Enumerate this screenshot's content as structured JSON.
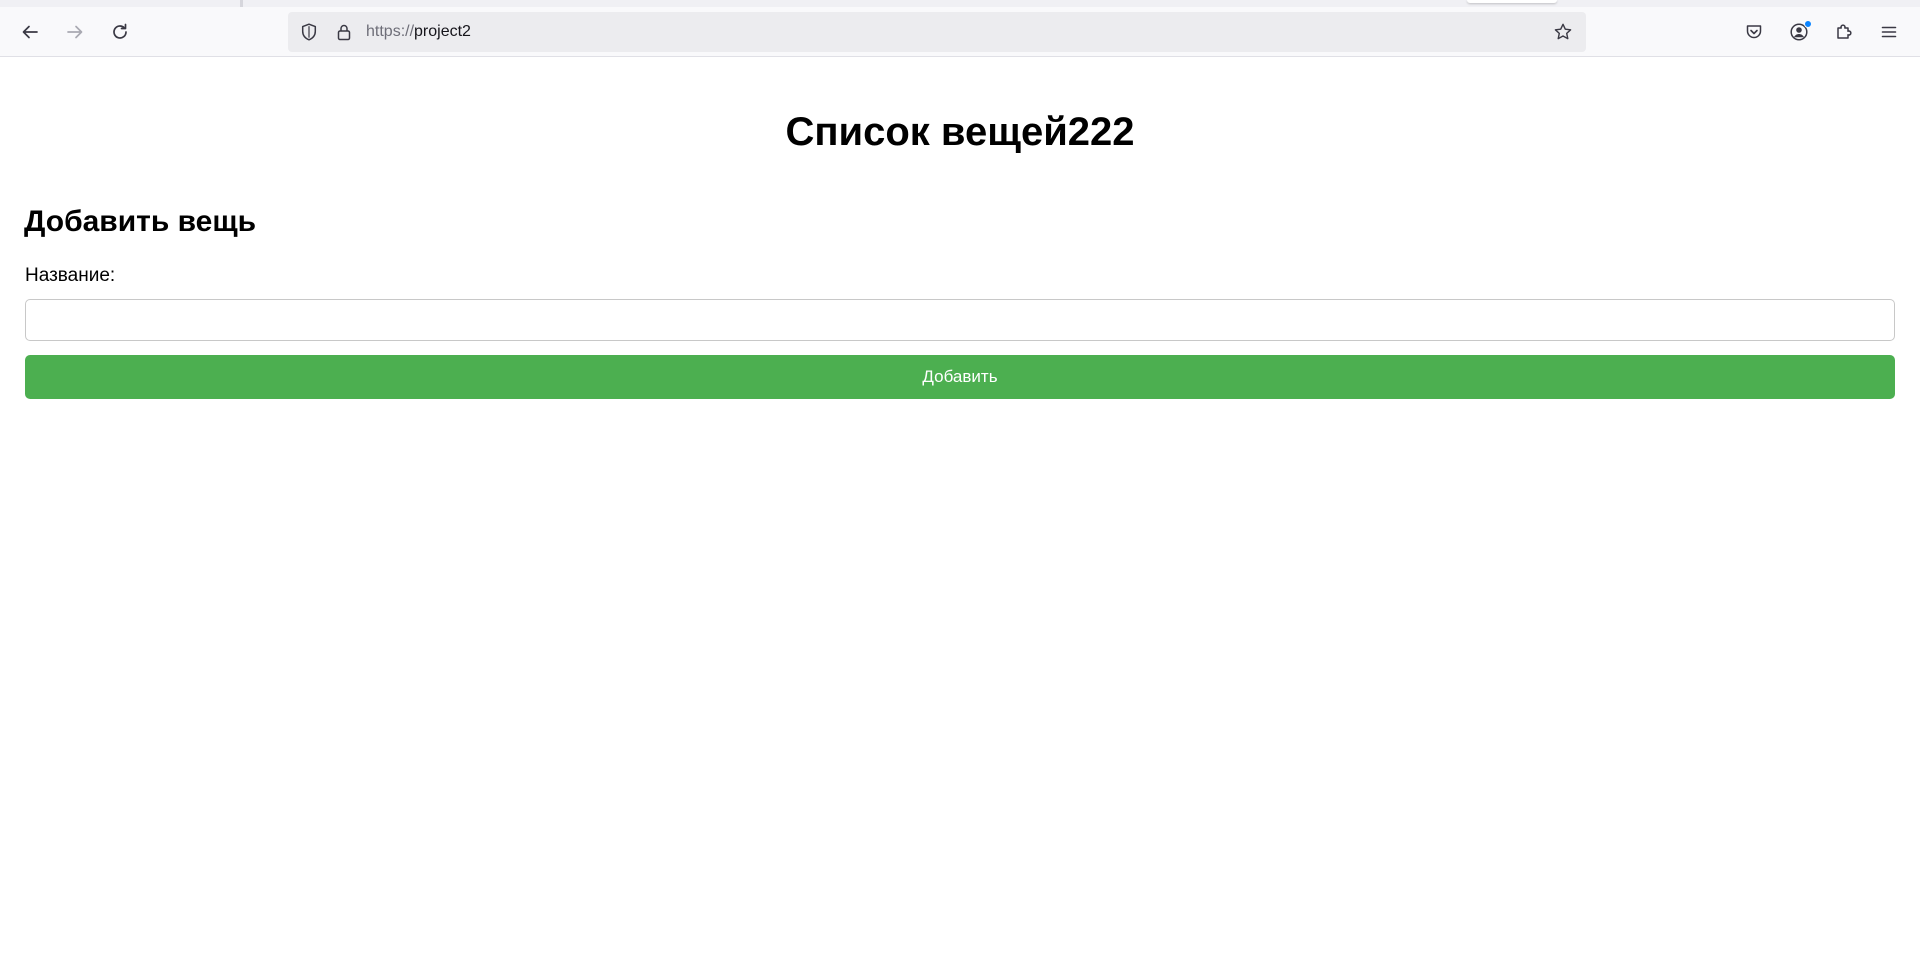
{
  "browser": {
    "url_scheme": "https://",
    "url_host": "project2",
    "icons": {
      "back": "back-arrow-icon",
      "forward": "forward-arrow-icon",
      "reload": "reload-icon",
      "tracking_protection": "shield-icon",
      "secure": "lock-icon",
      "bookmark": "star-icon",
      "pocket": "pocket-icon",
      "account": "account-icon",
      "extensions": "puzzle-icon",
      "menu": "hamburger-menu-icon"
    },
    "colors": {
      "notification_dot": "#0a84ff"
    }
  },
  "page": {
    "title": "Список вещей222",
    "form": {
      "heading": "Добавить вещь",
      "name_label": "Название:",
      "name_value": "",
      "submit_label": "Добавить"
    },
    "colors": {
      "submit_bg": "#4caf50",
      "submit_text": "#ffffff"
    }
  }
}
